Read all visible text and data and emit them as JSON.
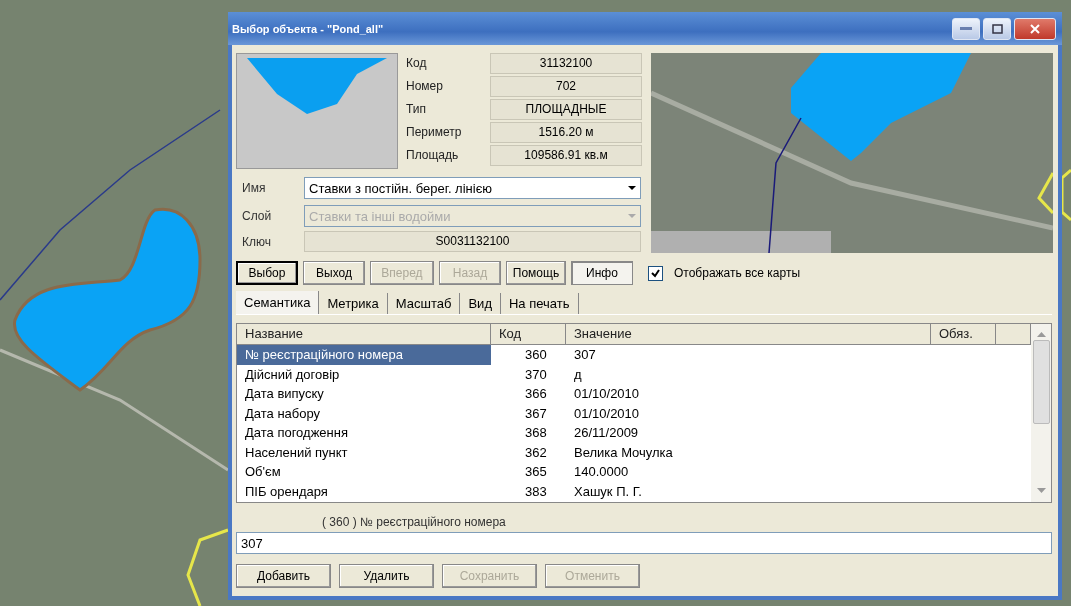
{
  "window": {
    "title": "Выбор объекта - \"Pond_all\""
  },
  "properties": [
    {
      "label": "Код",
      "value": "31132100"
    },
    {
      "label": "Номер",
      "value": "702"
    },
    {
      "label": "Тип",
      "value": "ПЛОЩАДНЫЕ"
    },
    {
      "label": "Периметр",
      "value": "1516.20  м"
    },
    {
      "label": "Площадь",
      "value": "109586.91  кв.м"
    }
  ],
  "name_field": {
    "label": "Имя",
    "value": "Ставки з постійн. берег. лінією",
    "disabled": false
  },
  "layer_field": {
    "label": "Слой",
    "value": "Ставки та інші водойми",
    "disabled": true
  },
  "key_field": {
    "label": "Ключ",
    "value": "S0031132100"
  },
  "nav_buttons": [
    {
      "label": "Выбор",
      "disabled": false,
      "pressed": false,
      "default": true
    },
    {
      "label": "Выход",
      "disabled": false,
      "pressed": false,
      "default": false
    },
    {
      "label": "Вперед",
      "disabled": true,
      "pressed": false,
      "default": false
    },
    {
      "label": "Назад",
      "disabled": true,
      "pressed": false,
      "default": false
    },
    {
      "label": "Помощь",
      "disabled": false,
      "pressed": false,
      "default": false
    },
    {
      "label": "Инфо",
      "disabled": false,
      "pressed": true,
      "default": false
    }
  ],
  "show_all_maps": {
    "label": "Отображать все карты",
    "checked": true
  },
  "tabs": [
    {
      "label": "Семантика",
      "selected": true
    },
    {
      "label": "Метрика",
      "selected": false
    },
    {
      "label": "Масштаб",
      "selected": false
    },
    {
      "label": "Вид",
      "selected": false
    },
    {
      "label": "На печать",
      "selected": false
    }
  ],
  "table": {
    "columns": [
      "Название",
      "Код",
      "Значение",
      "Обяз."
    ],
    "rows": [
      {
        "cells": [
          "№ реєстраційного номера",
          "360",
          "307",
          ""
        ],
        "selected": true
      },
      {
        "cells": [
          "Дійсний договір",
          "370",
          "д",
          ""
        ],
        "selected": false
      },
      {
        "cells": [
          "Дата випуску",
          "366",
          "01/10/2010",
          ""
        ],
        "selected": false
      },
      {
        "cells": [
          "Дата набору",
          "367",
          "01/10/2010",
          ""
        ],
        "selected": false
      },
      {
        "cells": [
          "Дата погодження",
          "368",
          "26/11/2009",
          ""
        ],
        "selected": false
      },
      {
        "cells": [
          "Населений пункт",
          "362",
          "Велика Мочулка",
          ""
        ],
        "selected": false
      },
      {
        "cells": [
          "Об'єм",
          "365",
          "140.0000",
          ""
        ],
        "selected": false
      },
      {
        "cells": [
          "ПІБ орендаря",
          "383",
          "Хашук П. Г.",
          ""
        ],
        "selected": false
      }
    ]
  },
  "edit_caption": "( 360 ) № реєстраційного номера",
  "edit_value": "307",
  "action_buttons": [
    {
      "label": "Добавить",
      "disabled": false
    },
    {
      "label": "Удалить",
      "disabled": false
    },
    {
      "label": "Сохранить",
      "disabled": true
    },
    {
      "label": "Отменить",
      "disabled": true
    }
  ]
}
